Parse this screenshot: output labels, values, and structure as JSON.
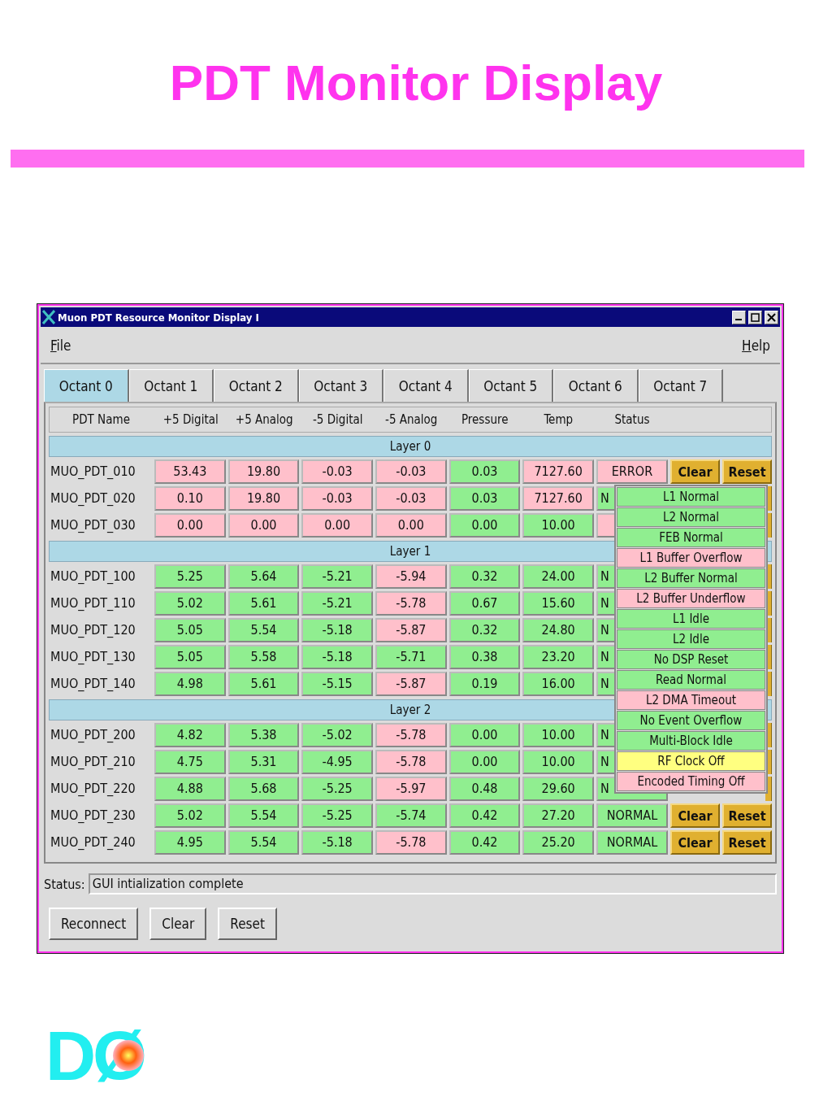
{
  "slide": {
    "title": "PDT Monitor Display",
    "logo": "DØ"
  },
  "window": {
    "title": "Muon PDT Resource Monitor Display I"
  },
  "menu": [
    "File",
    "Help"
  ],
  "tabs": [
    {
      "label": "Octant 0",
      "selected": true
    },
    {
      "label": "Octant 1",
      "selected": false
    },
    {
      "label": "Octant 2",
      "selected": false
    },
    {
      "label": "Octant 3",
      "selected": false
    },
    {
      "label": "Octant 4",
      "selected": false
    },
    {
      "label": "Octant 5",
      "selected": false
    },
    {
      "label": "Octant 6",
      "selected": false
    },
    {
      "label": "Octant 7",
      "selected": false
    }
  ],
  "columns": [
    "PDT Name",
    "+5 Digital",
    "+5 Analog",
    "-5 Digital",
    "-5 Analog",
    "Pressure",
    "Temp",
    "Status"
  ],
  "layers": [
    {
      "title": "Layer 0",
      "rows": [
        {
          "name": "MUO_PDT_010",
          "cells": [
            {
              "text": "53.43",
              "color": "#ffc0cb"
            },
            {
              "text": "19.80",
              "color": "#ffc0cb"
            },
            {
              "text": "-0.03",
              "color": "#ffc0cb"
            },
            {
              "text": "-0.03",
              "color": "#ffc0cb"
            },
            {
              "text": "0.03",
              "color": "#90ee90"
            },
            {
              "text": "7127.60",
              "color": "#ffc0cb"
            }
          ],
          "status": {
            "text": "ERROR",
            "color": "#ffc0cb"
          },
          "actions": [
            "Clear",
            "Reset"
          ]
        },
        {
          "name": "MUO_PDT_020",
          "cells": [
            {
              "text": "0.10",
              "color": "#ffc0cb"
            },
            {
              "text": "19.80",
              "color": "#ffc0cb"
            },
            {
              "text": "-0.03",
              "color": "#ffc0cb"
            },
            {
              "text": "-0.03",
              "color": "#ffc0cb"
            },
            {
              "text": "0.03",
              "color": "#90ee90"
            },
            {
              "text": "7127.60",
              "color": "#ffc0cb"
            }
          ],
          "status": {
            "text": "N",
            "color": "#90ee90"
          }
        },
        {
          "name": "MUO_PDT_030",
          "cells": [
            {
              "text": "0.00",
              "color": "#ffc0cb"
            },
            {
              "text": "0.00",
              "color": "#ffc0cb"
            },
            {
              "text": "0.00",
              "color": "#ffc0cb"
            },
            {
              "text": "0.00",
              "color": "#ffc0cb"
            },
            {
              "text": "0.00",
              "color": "#90ee90"
            },
            {
              "text": "10.00",
              "color": "#90ee90"
            }
          ],
          "status": {
            "color": "#ffc0cb"
          }
        }
      ]
    },
    {
      "title": "Layer 1",
      "rows": [
        {
          "name": "MUO_PDT_100",
          "cells": [
            {
              "text": "5.25",
              "color": "#90ee90"
            },
            {
              "text": "5.64",
              "color": "#90ee90"
            },
            {
              "text": "-5.21",
              "color": "#90ee90"
            },
            {
              "text": "-5.94",
              "color": "#ffc0cb"
            },
            {
              "text": "0.32",
              "color": "#90ee90"
            },
            {
              "text": "24.00",
              "color": "#90ee90"
            }
          ],
          "status": {
            "text": "N",
            "color": "#90ee90"
          }
        },
        {
          "name": "MUO_PDT_110",
          "cells": [
            {
              "text": "5.02",
              "color": "#90ee90"
            },
            {
              "text": "5.61",
              "color": "#90ee90"
            },
            {
              "text": "-5.21",
              "color": "#90ee90"
            },
            {
              "text": "-5.78",
              "color": "#ffc0cb"
            },
            {
              "text": "0.67",
              "color": "#90ee90"
            },
            {
              "text": "15.60",
              "color": "#90ee90"
            }
          ],
          "status": {
            "text": "N",
            "color": "#90ee90"
          }
        },
        {
          "name": "MUO_PDT_120",
          "cells": [
            {
              "text": "5.05",
              "color": "#90ee90"
            },
            {
              "text": "5.54",
              "color": "#90ee90"
            },
            {
              "text": "-5.18",
              "color": "#90ee90"
            },
            {
              "text": "-5.87",
              "color": "#ffc0cb"
            },
            {
              "text": "0.32",
              "color": "#90ee90"
            },
            {
              "text": "24.80",
              "color": "#90ee90"
            }
          ],
          "status": {
            "text": "N",
            "color": "#90ee90"
          }
        },
        {
          "name": "MUO_PDT_130",
          "cells": [
            {
              "text": "5.05",
              "color": "#90ee90"
            },
            {
              "text": "5.58",
              "color": "#90ee90"
            },
            {
              "text": "-5.18",
              "color": "#90ee90"
            },
            {
              "text": "-5.71",
              "color": "#90ee90"
            },
            {
              "text": "0.38",
              "color": "#90ee90"
            },
            {
              "text": "23.20",
              "color": "#90ee90"
            }
          ],
          "status": {
            "text": "N",
            "color": "#90ee90"
          }
        },
        {
          "name": "MUO_PDT_140",
          "cells": [
            {
              "text": "4.98",
              "color": "#90ee90"
            },
            {
              "text": "5.61",
              "color": "#90ee90"
            },
            {
              "text": "-5.15",
              "color": "#90ee90"
            },
            {
              "text": "-5.87",
              "color": "#ffc0cb"
            },
            {
              "text": "0.19",
              "color": "#90ee90"
            },
            {
              "text": "16.00",
              "color": "#90ee90"
            }
          ],
          "status": {
            "text": "N",
            "color": "#90ee90"
          }
        }
      ]
    },
    {
      "title": "Layer 2",
      "rows": [
        {
          "name": "MUO_PDT_200",
          "cells": [
            {
              "text": "4.82",
              "color": "#90ee90"
            },
            {
              "text": "5.38",
              "color": "#90ee90"
            },
            {
              "text": "-5.02",
              "color": "#90ee90"
            },
            {
              "text": "-5.78",
              "color": "#ffc0cb"
            },
            {
              "text": "0.00",
              "color": "#90ee90"
            },
            {
              "text": "10.00",
              "color": "#90ee90"
            }
          ],
          "status": {
            "text": "N",
            "color": "#90ee90"
          }
        },
        {
          "name": "MUO_PDT_210",
          "cells": [
            {
              "text": "4.75",
              "color": "#90ee90"
            },
            {
              "text": "5.31",
              "color": "#90ee90"
            },
            {
              "text": "-4.95",
              "color": "#90ee90"
            },
            {
              "text": "-5.78",
              "color": "#ffc0cb"
            },
            {
              "text": "0.00",
              "color": "#90ee90"
            },
            {
              "text": "10.00",
              "color": "#90ee90"
            }
          ],
          "status": {
            "text": "N",
            "color": "#90ee90"
          }
        },
        {
          "name": "MUO_PDT_220",
          "cells": [
            {
              "text": "4.88",
              "color": "#90ee90"
            },
            {
              "text": "5.68",
              "color": "#90ee90"
            },
            {
              "text": "-5.25",
              "color": "#90ee90"
            },
            {
              "text": "-5.97",
              "color": "#ffc0cb"
            },
            {
              "text": "0.48",
              "color": "#90ee90"
            },
            {
              "text": "29.60",
              "color": "#90ee90"
            }
          ],
          "status": {
            "text": "N",
            "color": "#90ee90"
          }
        },
        {
          "name": "MUO_PDT_230",
          "cells": [
            {
              "text": "5.02",
              "color": "#90ee90"
            },
            {
              "text": "5.54",
              "color": "#90ee90"
            },
            {
              "text": "-5.25",
              "color": "#90ee90"
            },
            {
              "text": "-5.74",
              "color": "#90ee90"
            },
            {
              "text": "0.42",
              "color": "#90ee90"
            },
            {
              "text": "27.20",
              "color": "#90ee90"
            }
          ],
          "status": {
            "text": "NORMAL",
            "color": "#90ee90"
          },
          "actions": [
            "Clear",
            "Reset"
          ]
        },
        {
          "name": "MUO_PDT_240",
          "cells": [
            {
              "text": "4.95",
              "color": "#90ee90"
            },
            {
              "text": "5.54",
              "color": "#90ee90"
            },
            {
              "text": "-5.18",
              "color": "#90ee90"
            },
            {
              "text": "-5.78",
              "color": "#ffc0cb"
            },
            {
              "text": "0.42",
              "color": "#90ee90"
            },
            {
              "text": "25.20",
              "color": "#90ee90"
            }
          ],
          "status": {
            "text": "NORMAL",
            "color": "#90ee90"
          },
          "actions": [
            "Clear",
            "Reset"
          ]
        }
      ]
    }
  ],
  "status_popup": {
    "items": [
      {
        "label": "L1 Normal",
        "color": "#90ee90"
      },
      {
        "label": "L2 Normal",
        "color": "#90ee90"
      },
      {
        "label": "FEB Normal",
        "color": "#90ee90"
      },
      {
        "label": "L1 Buffer Overflow",
        "color": "#ffc0cb"
      },
      {
        "label": "L2 Buffer Normal",
        "color": "#90ee90"
      },
      {
        "label": "L2 Buffer Underflow",
        "color": "#ffc0cb"
      },
      {
        "label": "L1 Idle",
        "color": "#90ee90"
      },
      {
        "label": "L2 Idle",
        "color": "#90ee90"
      },
      {
        "label": "No DSP Reset",
        "color": "#90ee90"
      },
      {
        "label": "Read Normal",
        "color": "#90ee90"
      },
      {
        "label": "L2 DMA Timeout",
        "color": "#ffc0cb"
      },
      {
        "label": "No Event Overflow",
        "color": "#90ee90"
      },
      {
        "label": "Multi-Block Idle",
        "color": "#90ee90"
      },
      {
        "label": "RF Clock Off",
        "color": "#ffff80"
      },
      {
        "label": "Encoded Timing Off",
        "color": "#ffc0cb"
      }
    ]
  },
  "status_bar": {
    "label": "Status:",
    "value": "GUI intialization complete"
  },
  "buttons": [
    "Reconnect",
    "Clear",
    "Reset"
  ]
}
